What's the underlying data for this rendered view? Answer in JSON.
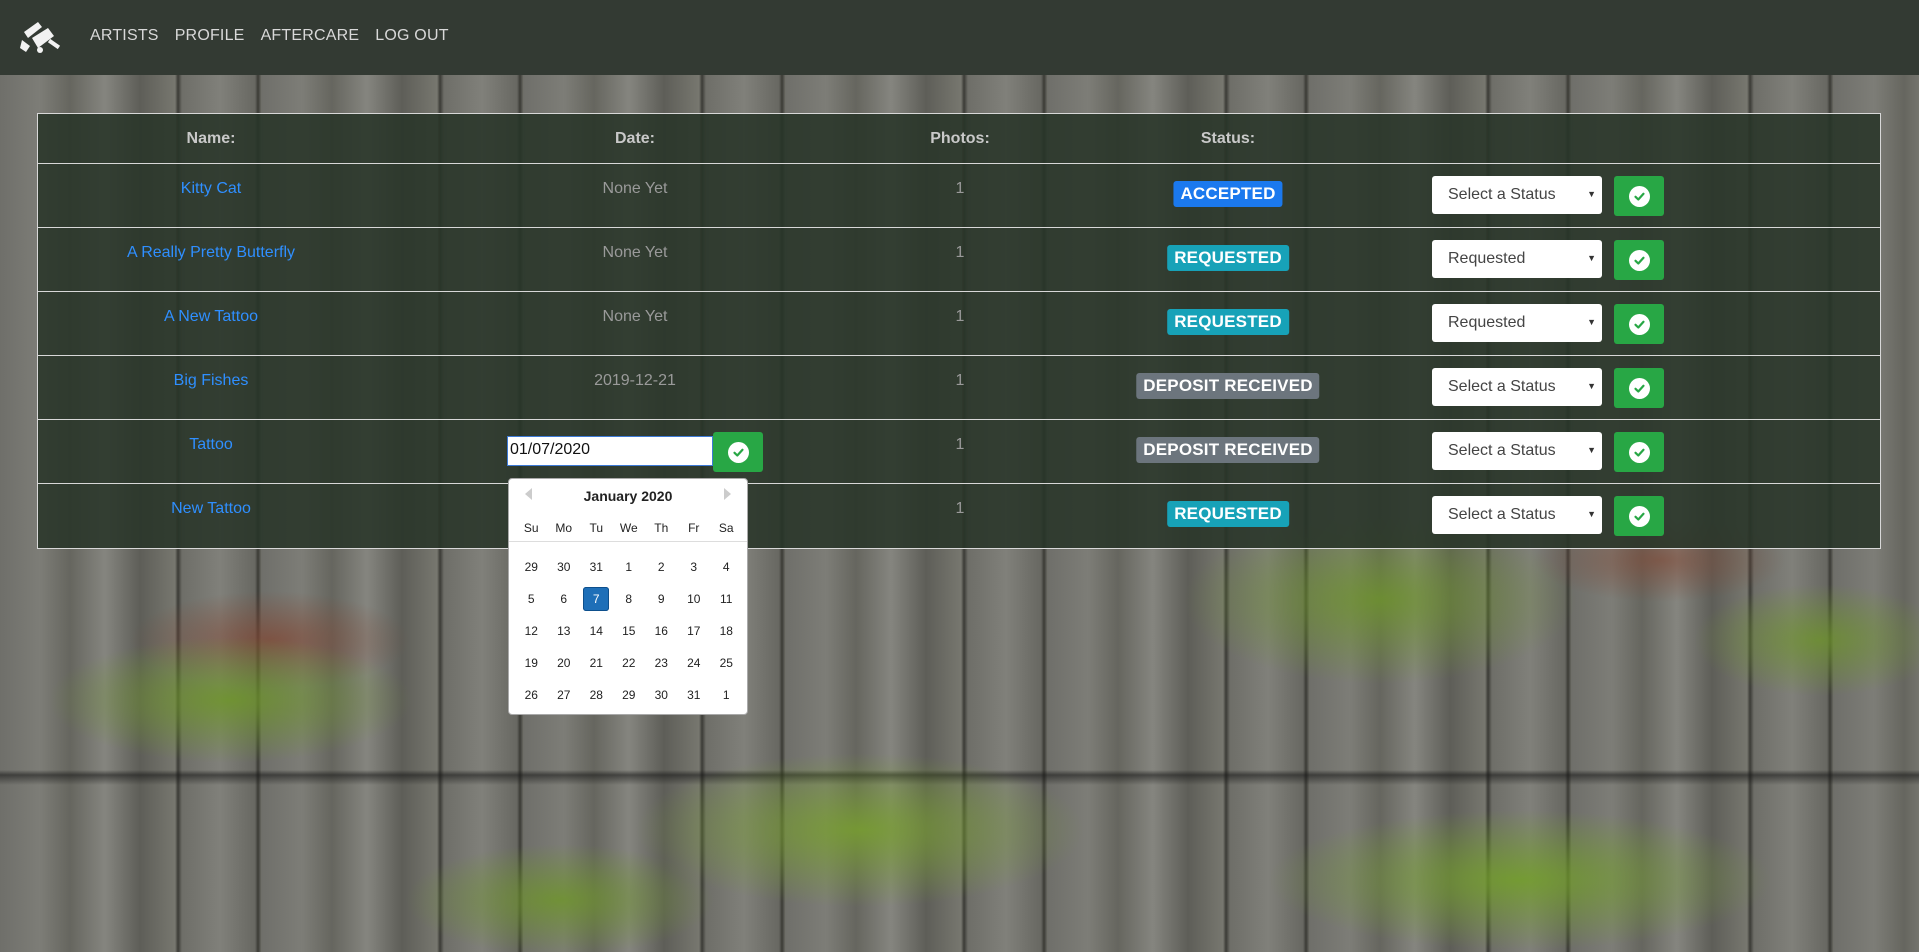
{
  "nav": {
    "logo_icon": "tattoo-machine-icon",
    "links": [
      "ARTISTS",
      "PROFILE",
      "AFTERCARE",
      "LOG OUT"
    ]
  },
  "table": {
    "headers": [
      "Name:",
      "Date:",
      "Photos:",
      "Status:"
    ],
    "rows": [
      {
        "name": "Kitty Cat",
        "date": "None Yet",
        "photos": "1",
        "status": "ACCEPTED",
        "select": "Select a Status"
      },
      {
        "name": "A Really Pretty Butterfly",
        "date": "None Yet",
        "photos": "1",
        "status": "REQUESTED",
        "select": "Requested"
      },
      {
        "name": "A New Tattoo",
        "date": "None Yet",
        "photos": "1",
        "status": "REQUESTED",
        "select": "Requested"
      },
      {
        "name": "Big Fishes",
        "date": "2019-12-21",
        "photos": "1",
        "status": "DEPOSIT RECEIVED",
        "select": "Select a Status"
      },
      {
        "name": "Tattoo",
        "date_input": "01/07/2020",
        "photos": "1",
        "status": "DEPOSIT RECEIVED",
        "select": "Select a Status"
      },
      {
        "name": "New Tattoo",
        "date": "",
        "photos": "1",
        "status": "REQUESTED",
        "select": "Select a Status"
      }
    ],
    "status_colors": {
      "ACCEPTED": "#1b79ee",
      "REQUESTED": "#17a2b8",
      "DEPOSIT RECEIVED": "#6c757d"
    },
    "confirm_icon": "check-circle-icon",
    "confirm_color": "#28a745"
  },
  "datepicker": {
    "title": "January 2020",
    "weekdays": [
      "Su",
      "Mo",
      "Tu",
      "We",
      "Th",
      "Fr",
      "Sa"
    ],
    "weeks": [
      [
        "29",
        "30",
        "31",
        "1",
        "2",
        "3",
        "4"
      ],
      [
        "5",
        "6",
        "7",
        "8",
        "9",
        "10",
        "11"
      ],
      [
        "12",
        "13",
        "14",
        "15",
        "16",
        "17",
        "18"
      ],
      [
        "19",
        "20",
        "21",
        "22",
        "23",
        "24",
        "25"
      ],
      [
        "26",
        "27",
        "28",
        "29",
        "30",
        "31",
        "1"
      ]
    ],
    "selected": "7",
    "prev_icon": "chevron-left-icon",
    "next_icon": "chevron-right-icon"
  }
}
